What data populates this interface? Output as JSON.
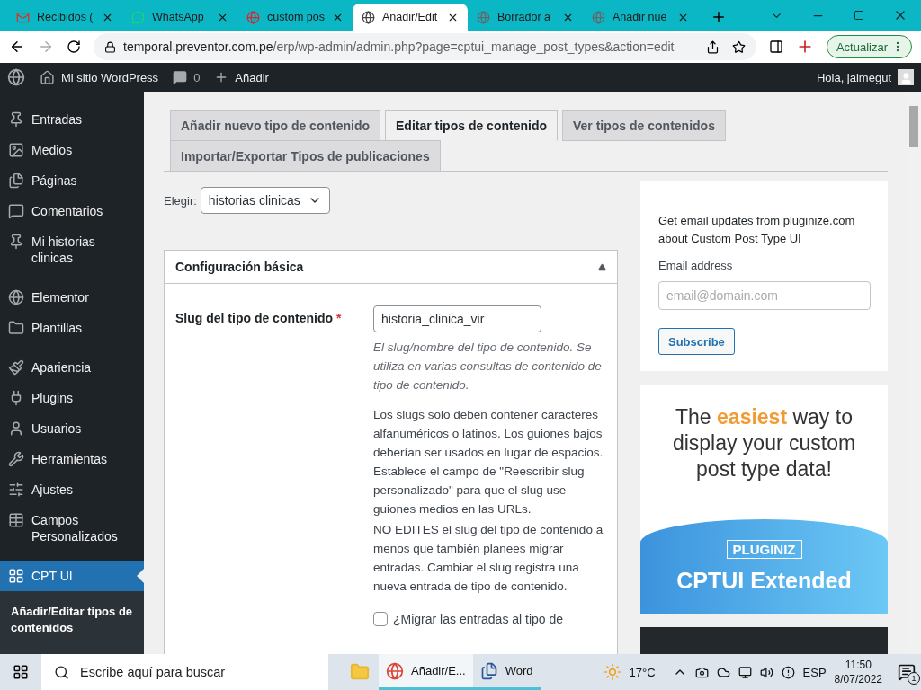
{
  "browser": {
    "tabs": [
      {
        "title": "Recibidos (",
        "selected": false
      },
      {
        "title": "WhatsApp",
        "selected": false
      },
      {
        "title": "custom pos",
        "selected": false
      },
      {
        "title": "Añadir/Edit",
        "selected": true
      },
      {
        "title": "Borrador a",
        "selected": false
      },
      {
        "title": "Añadir nue",
        "selected": false
      }
    ],
    "url_host": "temporal.preventor.com.pe",
    "url_path": "/erp/wp-admin/admin.php?page=cptui_manage_post_types&action=edit",
    "update_button": "Actualizar"
  },
  "admin_bar": {
    "site": "Mi sitio WordPress",
    "comments": "0",
    "new": "Añadir",
    "greeting": "Hola, jaimegut"
  },
  "sidebar": {
    "groups": [
      [
        {
          "label": "Entradas",
          "selected": false
        },
        {
          "label": "Medios",
          "selected": false
        },
        {
          "label": "Páginas",
          "selected": false
        },
        {
          "label": "Comentarios",
          "selected": false
        },
        {
          "label": "Mi historias clinicas",
          "selected": false
        }
      ],
      [
        {
          "label": "Elementor",
          "selected": false
        },
        {
          "label": "Plantillas",
          "selected": false
        }
      ],
      [
        {
          "label": "Apariencia",
          "selected": false
        },
        {
          "label": "Plugins",
          "selected": false
        },
        {
          "label": "Usuarios",
          "selected": false
        },
        {
          "label": "Herramientas",
          "selected": false
        },
        {
          "label": "Ajustes",
          "selected": false
        },
        {
          "label": "Campos Personalizados",
          "selected": false
        }
      ],
      [
        {
          "label": "CPT UI",
          "selected": true
        }
      ]
    ],
    "submenu": [
      {
        "label": "Añadir/Editar tipos de contenidos",
        "selected": true
      }
    ]
  },
  "tabs": [
    {
      "label": "Añadir nuevo tipo de contenido",
      "selected": false
    },
    {
      "label": "Editar tipos de contenido",
      "selected": true
    },
    {
      "label": "Ver tipos de contenidos",
      "selected": false
    },
    {
      "label": "Importar/Exportar Tipos de publicaciones",
      "selected": false
    }
  ],
  "chooser": {
    "label": "Elegir:",
    "value": "historias clinicas"
  },
  "panel": {
    "title": "Configuración básica",
    "expanded": true,
    "field_label": "Slug del tipo de contenido",
    "required_mark": "*",
    "field_value": "historia_clinica_vir",
    "description": "El slug/nombre del tipo de contenido. Se utiliza en varias consultas de contenido de tipo de contenido.",
    "notes": [
      "Los slugs solo deben contener caracteres alfanuméricos o latinos. Los guiones bajos deberían ser usados en lugar de espacios. Establece el campo de \"Reescribir slug personalizado\" para que el slug use guiones medios en las URLs.",
      "NO EDITES el slug del tipo de contenido a menos que también planees migrar entradas. Cambiar el slug registra una nueva entrada de tipo de contenido."
    ],
    "migrate": {
      "label": "¿Migrar las entradas al tipo de",
      "checked": false
    }
  },
  "newsletter": {
    "heading": "Get email updates from pluginize.com about Custom Post Type UI",
    "email_label": "Email address",
    "placeholder": "email@domain.com",
    "button": "Subscribe"
  },
  "ad": {
    "headline": "The **easiest** way to display your custom post type data!",
    "brand": "PLUGINIZ",
    "product": "CPTUI Extended"
  },
  "taskbar": {
    "search_placeholder": "Escribe aquí para buscar",
    "apps": [
      {
        "label": "Añadir/E...",
        "selected": true
      },
      {
        "label": "Word",
        "selected": false
      }
    ],
    "temperature": "17°C",
    "language": "ESP",
    "time": "11:50",
    "date": "8/07/2022",
    "notifications": "1"
  }
}
